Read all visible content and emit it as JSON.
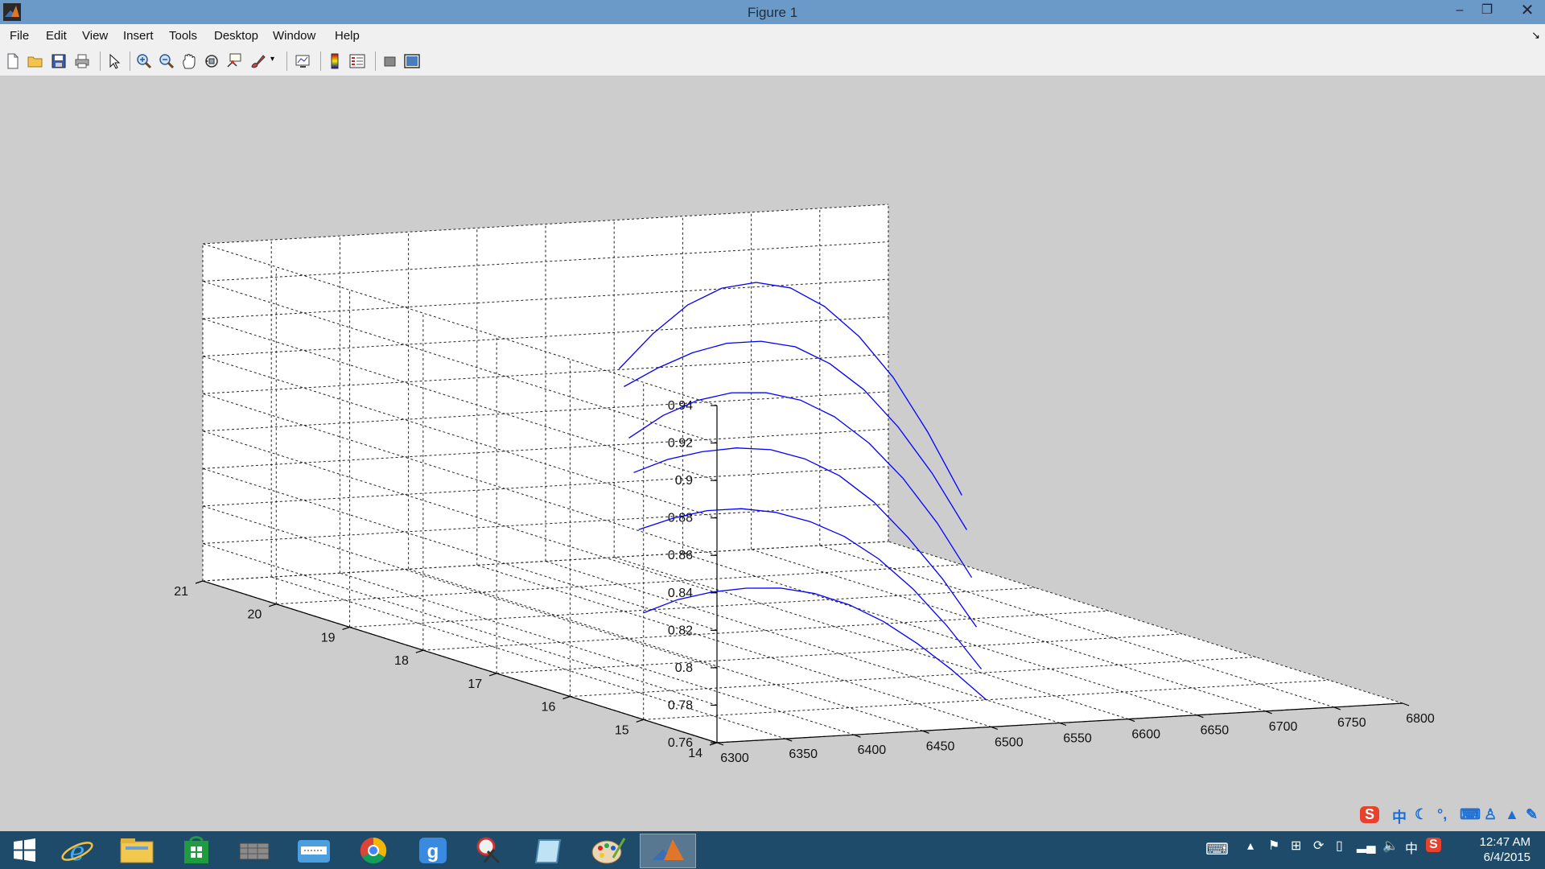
{
  "window": {
    "title": "Figure 1"
  },
  "menu": [
    "File",
    "Edit",
    "View",
    "Insert",
    "Tools",
    "Desktop",
    "Window",
    "Help"
  ],
  "toolbar_icons": [
    "new-figure",
    "open-file",
    "save",
    "print",
    "edit-plot-arrow",
    "zoom-in",
    "zoom-out",
    "pan",
    "rotate-3d",
    "data-cursor",
    "brush",
    "link-plot",
    "insert-colorbar",
    "insert-legend",
    "hide-plot-tools",
    "show-plot-tools"
  ],
  "chart_data": {
    "type": "line",
    "title": "",
    "xlabel": "",
    "ylabel": "",
    "zlabel": "",
    "x_axis": {
      "ticks": [
        6300,
        6350,
        6400,
        6450,
        6500,
        6550,
        6600,
        6650,
        6700,
        6750,
        6800
      ],
      "range": [
        6300,
        6800
      ]
    },
    "y_axis": {
      "ticks": [
        14,
        15,
        16,
        17,
        18,
        19,
        20,
        21
      ],
      "range": [
        14,
        21
      ]
    },
    "z_axis": {
      "ticks": [
        0.76,
        0.78,
        0.8,
        0.82,
        0.84,
        0.86,
        0.88,
        0.9,
        0.92,
        0.94
      ],
      "range": [
        0.76,
        0.94
      ]
    },
    "grid": true,
    "series": [
      {
        "y_level": 15,
        "x": [
          6300,
          6325,
          6350,
          6375,
          6400,
          6425,
          6450,
          6475,
          6500,
          6525,
          6550
        ],
        "z": [
          0.817,
          0.823,
          0.826,
          0.827,
          0.826,
          0.822,
          0.815,
          0.805,
          0.792,
          0.777,
          0.76
        ]
      },
      {
        "y_level": 16,
        "x": [
          6350,
          6375,
          6400,
          6425,
          6450,
          6475,
          6500,
          6525,
          6550,
          6575,
          6600
        ],
        "z": [
          0.847,
          0.852,
          0.855,
          0.855,
          0.852,
          0.846,
          0.837,
          0.824,
          0.807,
          0.786,
          0.762
        ]
      },
      {
        "y_level": 17,
        "x": [
          6400,
          6425,
          6450,
          6475,
          6500,
          6525,
          6550,
          6575,
          6600,
          6625,
          6650
        ],
        "z": [
          0.863,
          0.869,
          0.872,
          0.873,
          0.871,
          0.865,
          0.855,
          0.84,
          0.82,
          0.797,
          0.77
        ]
      },
      {
        "y_level": 18,
        "x": [
          6450,
          6475,
          6500,
          6525,
          6550,
          6575,
          6600,
          6625,
          6650,
          6675,
          6700
        ],
        "z": [
          0.867,
          0.878,
          0.885,
          0.888,
          0.887,
          0.882,
          0.872,
          0.857,
          0.837,
          0.812,
          0.782
        ]
      },
      {
        "y_level": 19,
        "x": [
          6500,
          6525,
          6550,
          6575,
          6600,
          6625,
          6650,
          6675,
          6700,
          6725,
          6750
        ],
        "z": [
          0.88,
          0.889,
          0.896,
          0.9,
          0.9,
          0.896,
          0.886,
          0.871,
          0.85,
          0.824,
          0.793
        ]
      },
      {
        "y_level": 20,
        "x": [
          6550,
          6575,
          6600,
          6625,
          6650,
          6675,
          6700,
          6725,
          6750,
          6775,
          6800
        ],
        "z": [
          0.875,
          0.893,
          0.907,
          0.915,
          0.917,
          0.913,
          0.902,
          0.885,
          0.862,
          0.832,
          0.797
        ]
      }
    ],
    "line_color": "#0000ff"
  },
  "taskbar": {
    "apps": [
      "windows-start",
      "internet-explorer",
      "file-explorer",
      "windows-store",
      "app-blocks",
      "app-grid-tool",
      "google-chrome",
      "app-g",
      "snipping-tool",
      "notepad",
      "paint",
      "matlab"
    ],
    "active_app": "matlab",
    "clock_time": "12:47 AM",
    "clock_date": "6/4/2015",
    "ime_label": "中"
  }
}
